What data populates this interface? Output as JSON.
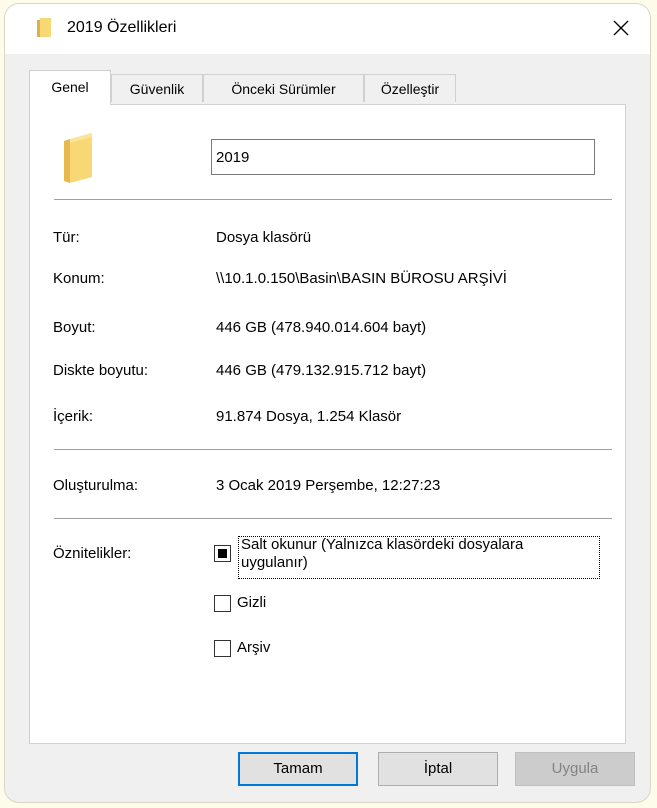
{
  "window": {
    "title": "2019 Özellikleri"
  },
  "tabs": [
    {
      "label": "Genel",
      "active": true
    },
    {
      "label": "Güvenlik",
      "active": false
    },
    {
      "label": "Önceki Sürümler",
      "active": false
    },
    {
      "label": "Özelleştir",
      "active": false
    }
  ],
  "general": {
    "name_value": "2019",
    "rows": [
      {
        "label": "Tür:",
        "value": "Dosya klasörü"
      },
      {
        "label": "Konum:",
        "value": "\\\\10.1.0.150\\Basin\\BASIN BÜROSU ARŞİVİ"
      },
      {
        "label": "Boyut:",
        "value": "446 GB (478.940.014.604 bayt)"
      },
      {
        "label": "Diskte boyutu:",
        "value": "446 GB (479.132.915.712 bayt)"
      },
      {
        "label": "İçerik:",
        "value": "91.874 Dosya, 1.254 Klasör"
      }
    ],
    "created_label": "Oluşturulma:",
    "created_value": "3 Ocak 2019 Perşembe, 12:27:23",
    "attributes_label": "Öznitelikler:",
    "attributes": {
      "readonly_line1": "Salt okunur (Yalnızca klasördeki dosyalara",
      "readonly_line2": "uygulanır)",
      "readonly_state": "indeterminate",
      "hidden_label": "Gizli",
      "hidden_checked": false,
      "archive_label": "Arşiv",
      "archive_checked": false
    }
  },
  "buttons": {
    "ok": "Tamam",
    "cancel": "İptal",
    "apply": "Uygula"
  },
  "colors": {
    "folder": "#f8d775",
    "accent": "#0078d7",
    "disabled_text": "#838383"
  }
}
